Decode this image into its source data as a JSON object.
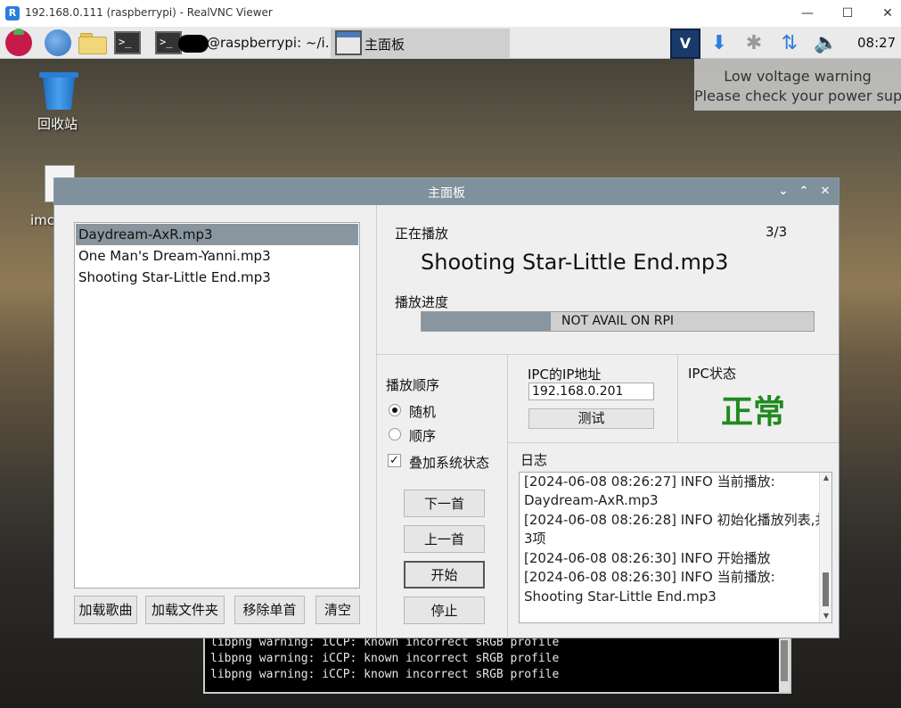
{
  "viewer": {
    "title": "192.168.0.111 (raspberrypi) - RealVNC Viewer",
    "icon": "vnc-viewer-icon",
    "minimize": "—",
    "maximize": "☐",
    "close": "✕"
  },
  "taskbar": {
    "terminal_prompt": ">_",
    "terminal_title": "@raspberrypi: ~/i...",
    "active_window": "主面板",
    "vnc_label": "V",
    "clock": "08:27",
    "status_icons": [
      "download-icon",
      "bluetooth-icon",
      "network-transfer-icon",
      "volume-icon"
    ]
  },
  "toast": {
    "line1": "Low voltage warning",
    "line2": "Please check your power supply"
  },
  "desktop": {
    "trash_label": "回收站",
    "file_label": "imc"
  },
  "console": {
    "lines": [
      "libpng warning: iCCP: known incorrect sRGB profile",
      "libpng warning: iCCP: known incorrect sRGB profile",
      "libpng warning: iCCP: known incorrect sRGB profile"
    ]
  },
  "app": {
    "title": "主面板",
    "controls": {
      "collapse": "⌄",
      "expand": "⌃",
      "close": "✕"
    },
    "playlist": [
      "Daydream-AxR.mp3",
      "One Man's Dream-Yanni.mp3",
      "Shooting Star-Little End.mp3"
    ],
    "playlist_selected_index": 0,
    "buttons": {
      "load_song": "加载歌曲",
      "load_folder": "加载文件夹",
      "remove_one": "移除单首",
      "clear": "清空"
    },
    "now_playing": {
      "label": "正在播放",
      "track_counter": "3/3",
      "track": "Shooting Star-Little End.mp3"
    },
    "progress": {
      "label": "播放进度",
      "text": "NOT AVAIL ON RPI",
      "fraction": 0.33
    },
    "order": {
      "label": "播放顺序",
      "random": "随机",
      "sequential": "顺序",
      "selected": "random",
      "overlay": "叠加系统状态",
      "overlay_checked": true
    },
    "transport": {
      "next": "下一首",
      "prev": "上一首",
      "start": "开始",
      "stop": "停止"
    },
    "ipc": {
      "ip_label": "IPC的IP地址",
      "ip_value": "192.168.0.201",
      "test": "测试",
      "status_label": "IPC状态",
      "status_value": "正常",
      "status_color": "#1f8a1f"
    },
    "log": {
      "label": "日志",
      "lines": [
        "[2024-06-08 08:26:27] INFO 当前播放:",
        "Daydream-AxR.mp3",
        "[2024-06-08 08:26:28] INFO 初始化播放列表,共",
        "3项",
        "[2024-06-08 08:26:30] INFO 开始播放",
        "[2024-06-08 08:26:30] INFO 当前播放:",
        "Shooting Star-Little End.mp3"
      ]
    }
  }
}
